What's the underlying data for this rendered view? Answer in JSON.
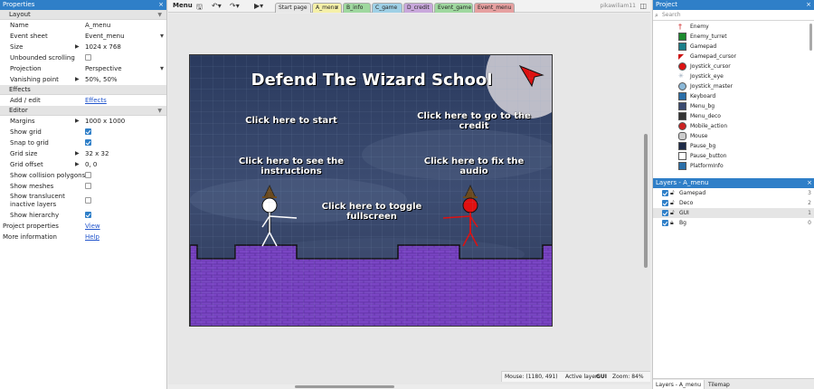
{
  "properties": {
    "title": "Properties",
    "close": "×",
    "sections": {
      "layout": "Layout",
      "effects": "Effects",
      "editor": "Editor"
    },
    "layout_rows": [
      {
        "label": "Name",
        "value": "A_menu"
      },
      {
        "label": "Event sheet",
        "value": "Event_menu"
      },
      {
        "label": "Size",
        "value": "1024 x 768"
      },
      {
        "label": "Unbounded scrolling",
        "value": ""
      },
      {
        "label": "Projection",
        "value": "Perspective"
      },
      {
        "label": "Vanishing point",
        "value": "50%, 50%"
      }
    ],
    "effects_row": {
      "label": "Add / edit",
      "value": "Effects"
    },
    "editor_rows": [
      {
        "label": "Margins",
        "value": "1000 x 1000"
      },
      {
        "label": "Show grid",
        "value": ""
      },
      {
        "label": "Snap to grid",
        "value": ""
      },
      {
        "label": "Grid size",
        "value": "32 x 32"
      },
      {
        "label": "Grid offset",
        "value": "0, 0"
      },
      {
        "label": "Show collision polygons",
        "value": ""
      },
      {
        "label": "Show meshes",
        "value": ""
      },
      {
        "label": "Show translucent inactive layers",
        "value": ""
      },
      {
        "label": "Show hierarchy",
        "value": ""
      }
    ],
    "project_row": {
      "label": "Project properties",
      "value": "View"
    },
    "more_row": {
      "label": "More information",
      "value": "Help"
    }
  },
  "toolbar": {
    "menu_label": "Menu",
    "user": "pikawiliam11",
    "tabs": [
      {
        "label": "Start page",
        "color": "#e8e8e8"
      },
      {
        "label": "A_menu",
        "color": "#f5f0a8"
      },
      {
        "label": "B_info",
        "color": "#9fd89f"
      },
      {
        "label": "C_game",
        "color": "#9fd0e6"
      },
      {
        "label": "D_credit",
        "color": "#c9a8dc"
      },
      {
        "label": "Event_game",
        "color": "#9fd89f"
      },
      {
        "label": "Event_menu",
        "color": "#e6a0a0"
      }
    ],
    "close_glyph": "×"
  },
  "scene": {
    "title": "Defend The Wizard School",
    "opt_start": "Click here to start",
    "opt_credit_1": "Click here to go to the",
    "opt_credit_2": "credit",
    "opt_instr_1": "Click here to see the",
    "opt_instr_2": "instructions",
    "opt_audio_1": "Click here to fix the",
    "opt_audio_2": "audio",
    "opt_full_1": "Click here to toggle",
    "opt_full_2": "fullscreen"
  },
  "status": {
    "mouse": "Mouse: (1180, 491)",
    "active_layer_label": "Active layer:",
    "active_layer": "GUI",
    "zoom": "Zoom: 84%"
  },
  "project": {
    "title": "Project",
    "close": "×",
    "search_placeholder": "Search",
    "objects": [
      {
        "label": "Enemy",
        "icon": "enemy-icon",
        "color": "#cc2222"
      },
      {
        "label": "Enemy_turret",
        "icon": "turret-icon",
        "color": "#1b8a2e"
      },
      {
        "label": "Gamepad",
        "icon": "gamepad-icon",
        "color": "#1b7f8a"
      },
      {
        "label": "Gamepad_cursor",
        "icon": "cursor-icon",
        "color": "#cc1111"
      },
      {
        "label": "Joystick_cursor",
        "icon": "joystick-cursor-icon",
        "color": "#dd1111"
      },
      {
        "label": "Joystick_eye",
        "icon": "joystick-eye-icon",
        "color": "#99aabb"
      },
      {
        "label": "Joystick_master",
        "icon": "joystick-master-icon",
        "color": "#8ab8d8"
      },
      {
        "label": "Keyboard",
        "icon": "keyboard-icon",
        "color": "#2a6ea8"
      },
      {
        "label": "Menu_bg",
        "icon": "menu-bg-icon",
        "color": "#3a4a70"
      },
      {
        "label": "Menu_deco",
        "icon": "menu-deco-icon",
        "color": "#333333"
      },
      {
        "label": "Mobile_action",
        "icon": "mobile-action-icon",
        "color": "#cc2222"
      },
      {
        "label": "Mouse",
        "icon": "mouse-icon",
        "color": "#cccccc"
      },
      {
        "label": "Pause_bg",
        "icon": "pause-bg-icon",
        "color": "#1e2b48"
      },
      {
        "label": "Pause_button",
        "icon": "pause-button-icon",
        "color": "#ffffff"
      },
      {
        "label": "PlatformInfo",
        "icon": "platform-info-icon",
        "color": "#2a6ea8"
      }
    ]
  },
  "layers": {
    "title": "Layers - A_menu",
    "close": "×",
    "rows": [
      {
        "label": "Gamepad",
        "num": "3"
      },
      {
        "label": "Deco",
        "num": "2"
      },
      {
        "label": "GUI",
        "num": "1"
      },
      {
        "label": "Bg",
        "num": "0"
      }
    ],
    "bottom_tabs": [
      "Layers - A_menu",
      "Tilemap"
    ]
  }
}
